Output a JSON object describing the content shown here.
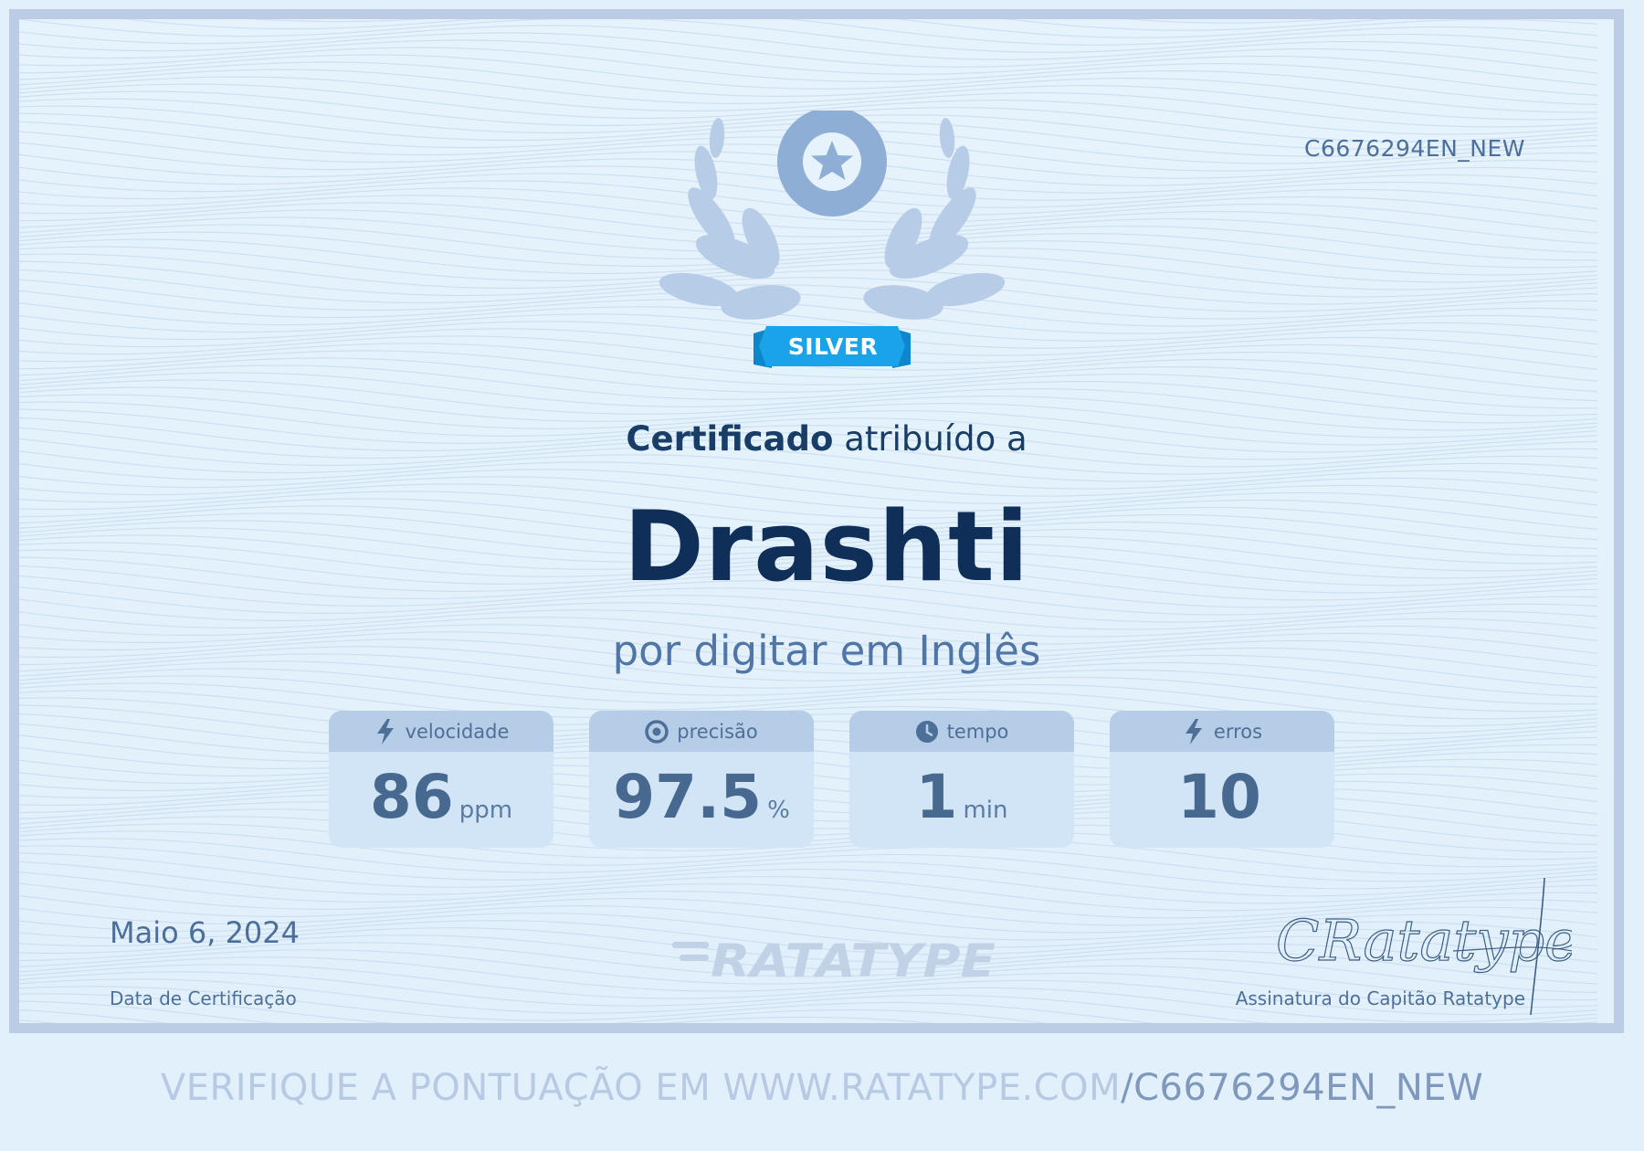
{
  "certificate": {
    "id": "C6676294EN_NEW",
    "badge_label": "SILVER",
    "awarded_bold": "Certificado",
    "awarded_rest": " atribuído a",
    "recipient_name": "Drashti",
    "subtitle": "por digitar em Inglês",
    "date": "Maio 6, 2024",
    "date_label": "Data de Certificação",
    "logo_text": "RATATYPE",
    "signature_text": "CRatatype",
    "signature_label": "Assinatura do Capitão Ratatype"
  },
  "stats": [
    {
      "label": "velocidade",
      "icon": "lightning-icon",
      "value": "86",
      "unit": "ppm"
    },
    {
      "label": "precisão",
      "icon": "target-icon",
      "value": "97.5",
      "unit": "%"
    },
    {
      "label": "tempo",
      "icon": "clock-icon",
      "value": "1",
      "unit": "min"
    },
    {
      "label": "erros",
      "icon": "lightning-icon",
      "value": "10",
      "unit": ""
    }
  ],
  "footer": {
    "verify_prefix": "VERIFIQUE A PONTUAÇÃO EM WWW.RATATYPE.COM",
    "verify_suffix": "/C6676294EN_NEW"
  },
  "colors": {
    "background": "#e1f0fb",
    "border": "#bccce4",
    "ribbon": "#1aa3e8",
    "badge": "#8fb0d6",
    "laurel": "#b5cbe6",
    "text_dark": "#0f2f58"
  }
}
